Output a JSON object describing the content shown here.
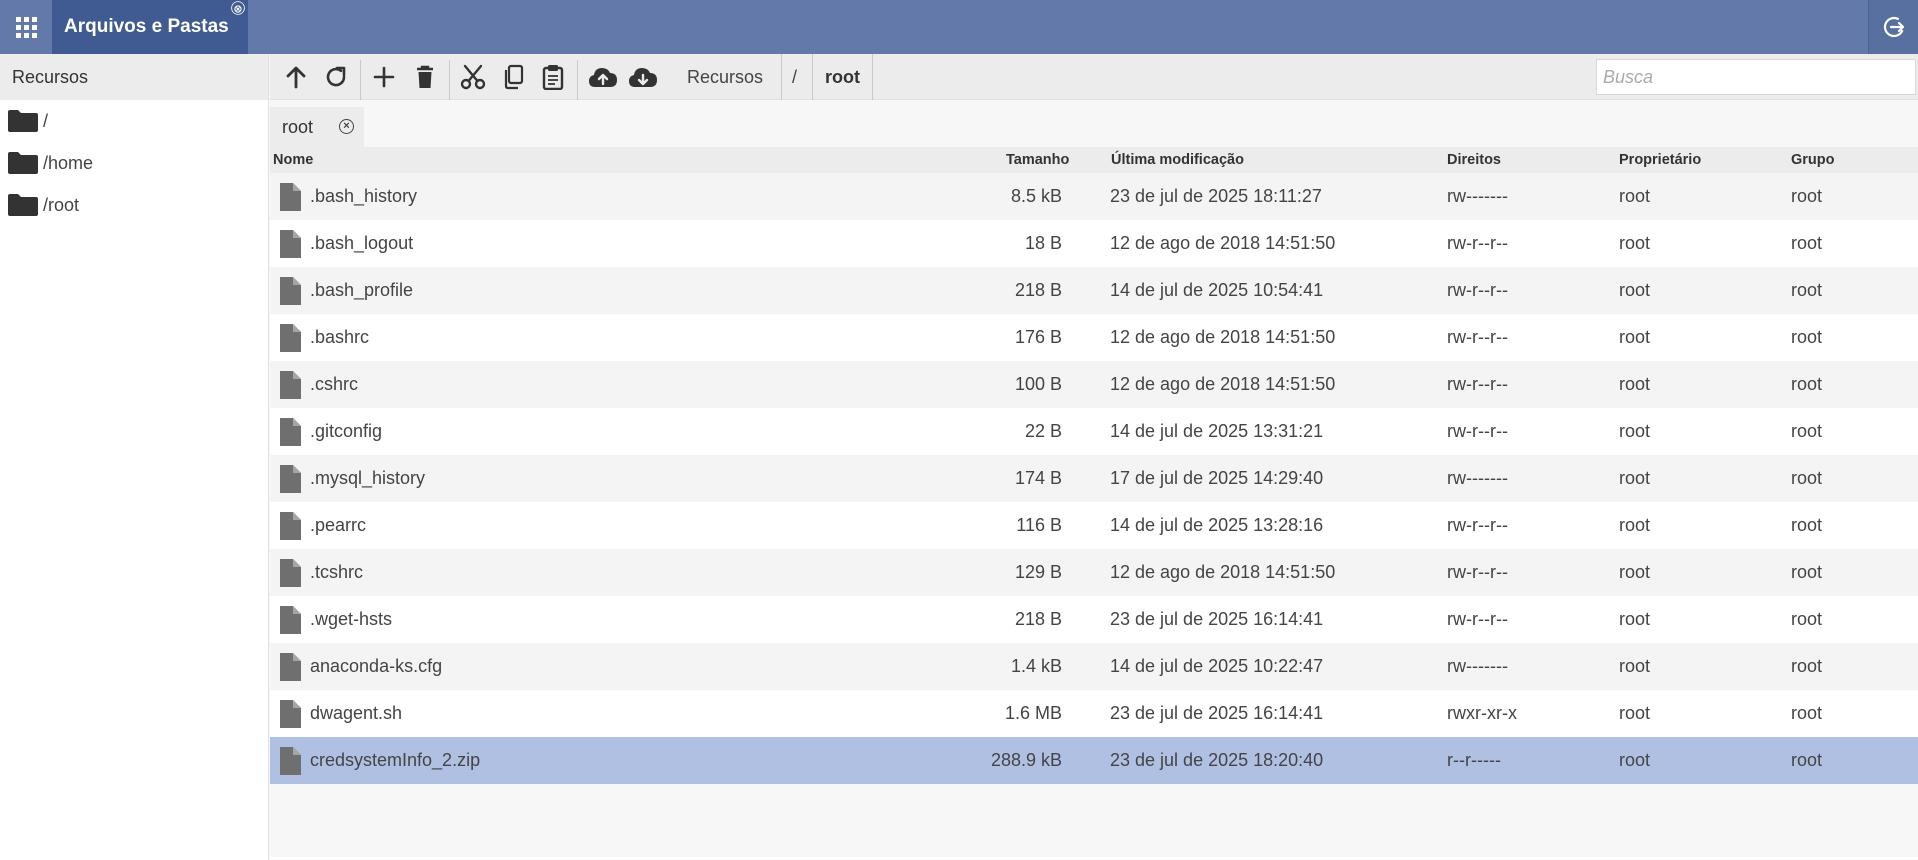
{
  "app": {
    "title": "Arquivos e Pastas",
    "close_glyph": "⊗"
  },
  "sidebar": {
    "header": "Recursos",
    "items": [
      {
        "label": "/"
      },
      {
        "label": "/home"
      },
      {
        "label": "/root"
      }
    ]
  },
  "toolbar": {
    "icons": [
      "arrow-up-icon",
      "refresh-icon",
      "plus-icon",
      "trash-icon",
      "scissors-icon",
      "copy-icon",
      "paste-icon",
      "cloud-upload-icon",
      "cloud-download-icon"
    ],
    "breadcrumb": {
      "root_label": "Recursos",
      "separator": "/",
      "current": "root"
    },
    "search_placeholder": "Busca"
  },
  "path_tab": {
    "label": "root",
    "close_glyph": "⊗"
  },
  "table": {
    "headers": {
      "name": "Nome",
      "size": "Tamanho",
      "modified": "Última modificação",
      "rights": "Direitos",
      "owner": "Proprietário",
      "group": "Grupo"
    },
    "rows": [
      {
        "name": ".bash_history",
        "size": "8.5 kB",
        "modified": "23 de jul de 2025 18:11:27",
        "rights": "rw-------",
        "owner": "root",
        "group": "root"
      },
      {
        "name": ".bash_logout",
        "size": "18 B",
        "modified": "12 de ago de 2018 14:51:50",
        "rights": "rw-r--r--",
        "owner": "root",
        "group": "root"
      },
      {
        "name": ".bash_profile",
        "size": "218 B",
        "modified": "14 de jul de 2025 10:54:41",
        "rights": "rw-r--r--",
        "owner": "root",
        "group": "root"
      },
      {
        "name": ".bashrc",
        "size": "176 B",
        "modified": "12 de ago de 2018 14:51:50",
        "rights": "rw-r--r--",
        "owner": "root",
        "group": "root"
      },
      {
        "name": ".cshrc",
        "size": "100 B",
        "modified": "12 de ago de 2018 14:51:50",
        "rights": "rw-r--r--",
        "owner": "root",
        "group": "root"
      },
      {
        "name": ".gitconfig",
        "size": "22 B",
        "modified": "14 de jul de 2025 13:31:21",
        "rights": "rw-r--r--",
        "owner": "root",
        "group": "root"
      },
      {
        "name": ".mysql_history",
        "size": "174 B",
        "modified": "17 de jul de 2025 14:29:40",
        "rights": "rw-------",
        "owner": "root",
        "group": "root"
      },
      {
        "name": ".pearrc",
        "size": "116 B",
        "modified": "14 de jul de 2025 13:28:16",
        "rights": "rw-r--r--",
        "owner": "root",
        "group": "root"
      },
      {
        "name": ".tcshrc",
        "size": "129 B",
        "modified": "12 de ago de 2018 14:51:50",
        "rights": "rw-r--r--",
        "owner": "root",
        "group": "root"
      },
      {
        "name": ".wget-hsts",
        "size": "218 B",
        "modified": "23 de jul de 2025 16:14:41",
        "rights": "rw-r--r--",
        "owner": "root",
        "group": "root"
      },
      {
        "name": "anaconda-ks.cfg",
        "size": "1.4 kB",
        "modified": "14 de jul de 2025 10:22:47",
        "rights": "rw-------",
        "owner": "root",
        "group": "root"
      },
      {
        "name": "dwagent.sh",
        "size": "1.6 MB",
        "modified": "23 de jul de 2025 16:14:41",
        "rights": "rwxr-xr-x",
        "owner": "root",
        "group": "root"
      },
      {
        "name": "credsystemInfo_2.zip",
        "size": "288.9 kB",
        "modified": "23 de jul de 2025 18:20:40",
        "rights": "r--r-----",
        "owner": "root",
        "group": "root",
        "selected": true
      }
    ]
  },
  "colors": {
    "topbar": "#6379aa",
    "app_tab": "#3f5b92",
    "selected_row": "#b0c0e3"
  }
}
